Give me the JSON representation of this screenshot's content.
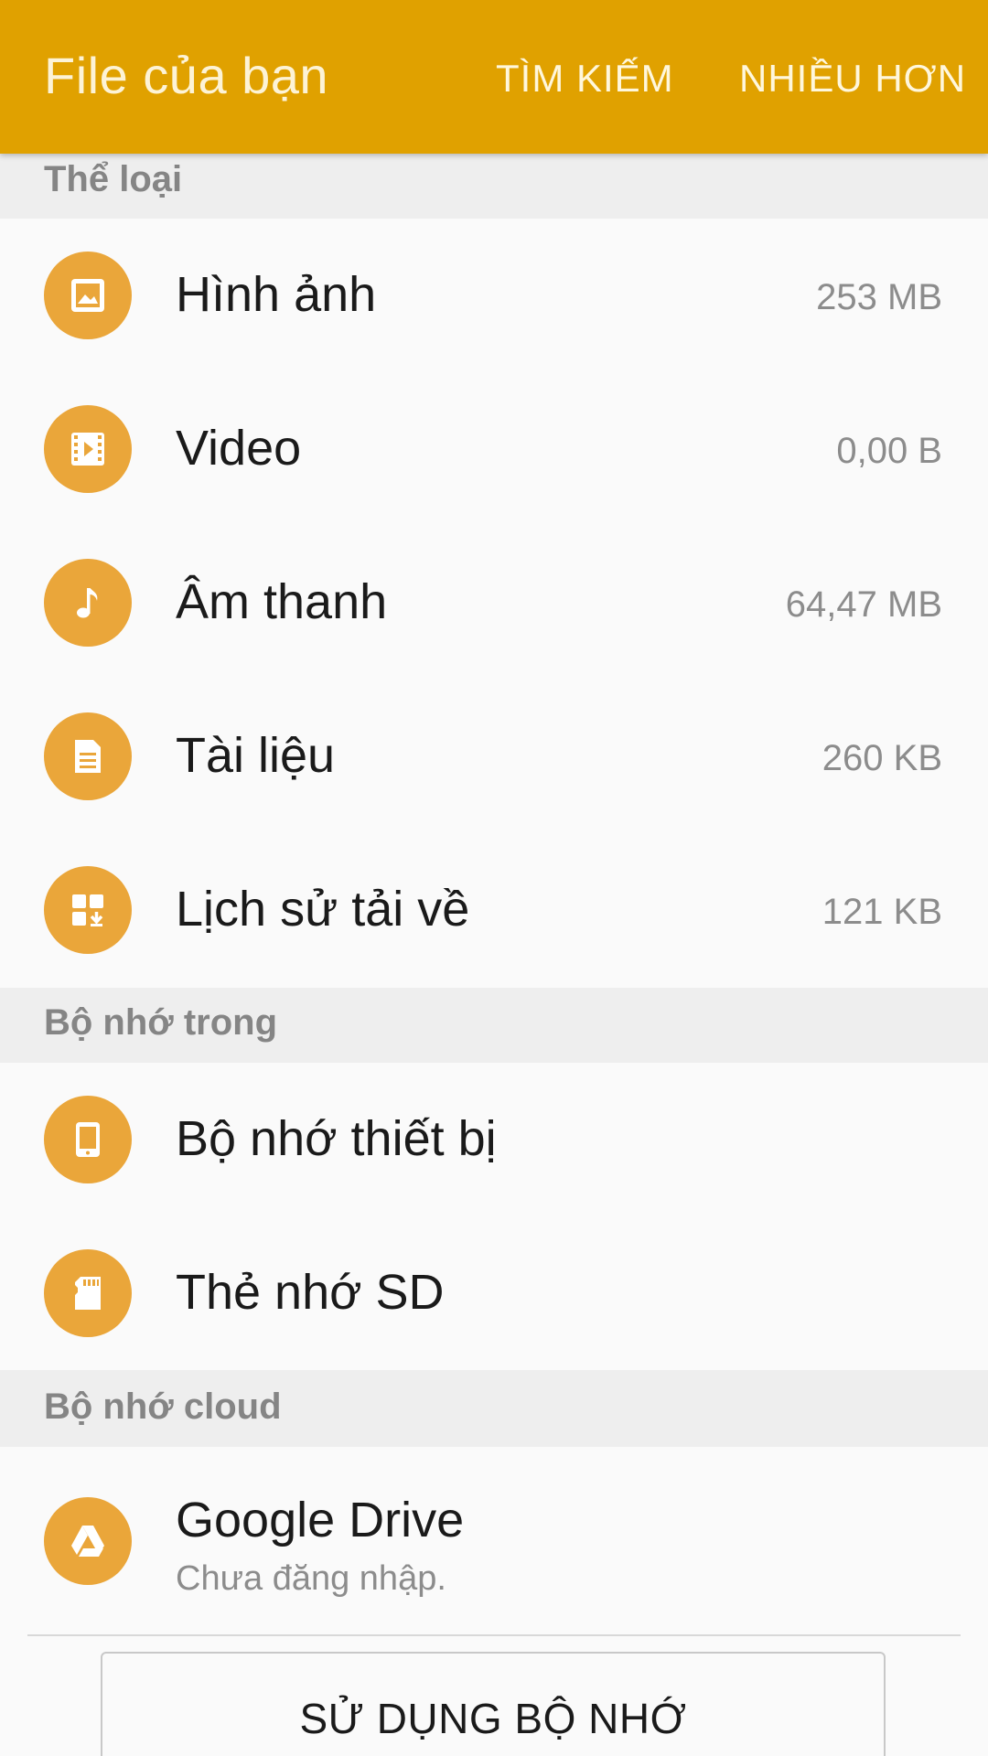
{
  "appbar": {
    "title": "File của bạn",
    "search_label": "TÌM KIẾM",
    "more_label": "NHIỀU HƠN",
    "color": "#e0a100"
  },
  "sections": {
    "categories": {
      "header": "Thể loại",
      "items": [
        {
          "label": "Hình ảnh",
          "size": "253 MB",
          "icon": "image-icon"
        },
        {
          "label": "Video",
          "size": "0,00 B",
          "icon": "video-icon"
        },
        {
          "label": "Âm thanh",
          "size": "64,47 MB",
          "icon": "music-note-icon"
        },
        {
          "label": "Tài liệu",
          "size": "260 KB",
          "icon": "document-icon"
        },
        {
          "label": "Lịch sử tải về",
          "size": "121 KB",
          "icon": "download-history-icon"
        }
      ]
    },
    "internal": {
      "header": "Bộ nhớ trong",
      "items": [
        {
          "label": "Bộ nhớ thiết bị",
          "icon": "device-icon"
        },
        {
          "label": "Thẻ nhớ SD",
          "icon": "sd-card-icon"
        }
      ]
    },
    "cloud": {
      "header": "Bộ nhớ cloud",
      "items": [
        {
          "label": "Google Drive",
          "sublabel": "Chưa đăng nhập.",
          "icon": "google-drive-icon"
        }
      ]
    }
  },
  "footer": {
    "storage_button_label": "SỬ DỤNG BỘ NHỚ"
  },
  "colors": {
    "icon_circle": "#eaa63a",
    "section_header_bg": "#eeeeee"
  }
}
